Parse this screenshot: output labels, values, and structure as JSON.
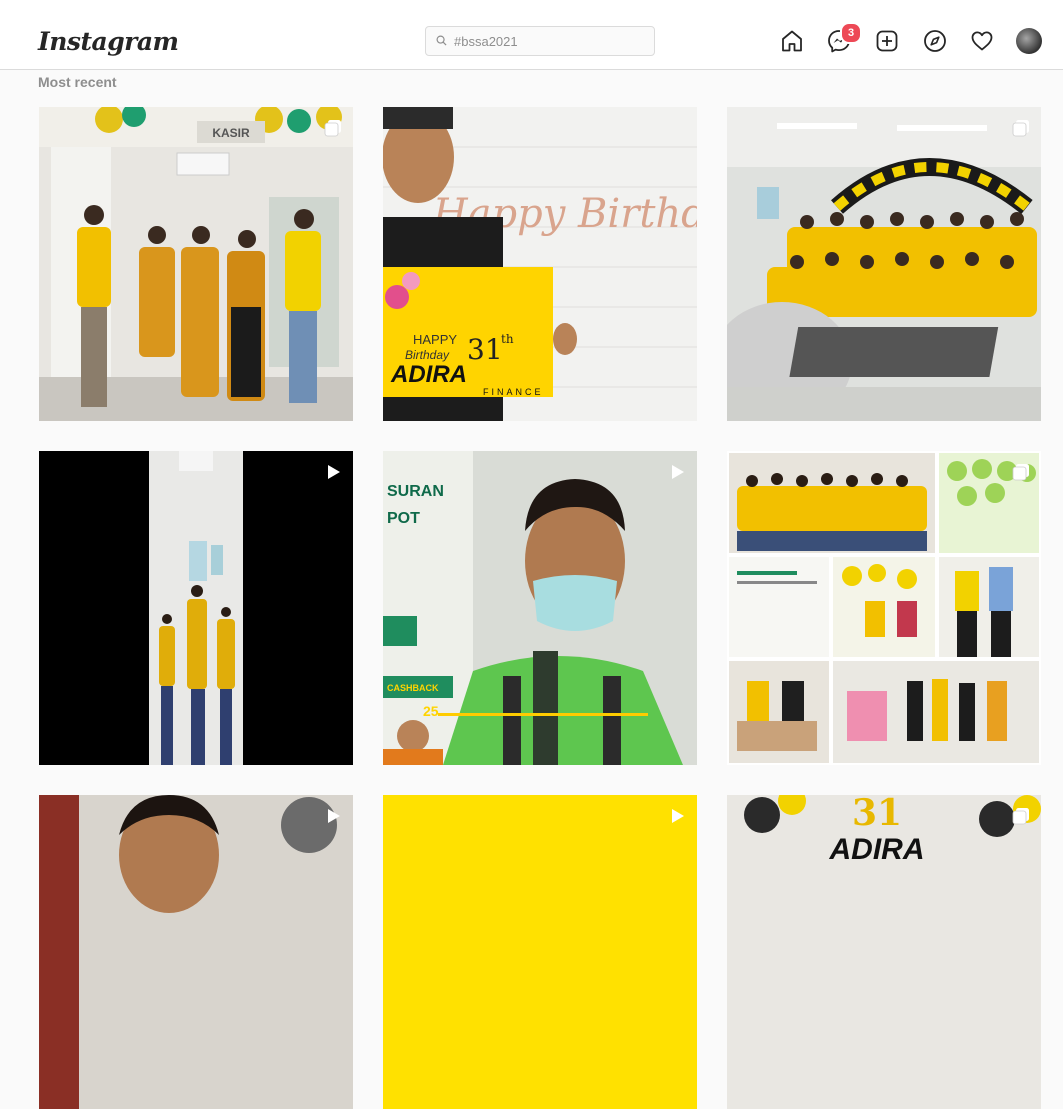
{
  "header": {
    "logo": "Instagram",
    "search_value": "#bssa2021",
    "messages_badge": "3"
  },
  "section": {
    "title": "Most recent"
  },
  "posts": [
    {
      "type": "album",
      "sign": "KASIR"
    },
    {
      "type": "photo",
      "script_text": "Happy Birthday",
      "card_happy": "HAPPY",
      "card_birthday": "Birthday",
      "card_number": "31",
      "card_suffix": "th",
      "brand": "ADIRA",
      "brand_sub": "FINANCE"
    },
    {
      "type": "album"
    },
    {
      "type": "video"
    },
    {
      "type": "video",
      "poster_line1": "SURAN",
      "poster_line2": "POT",
      "poster_cashback": "CASHBACK",
      "poster_amount": "25"
    },
    {
      "type": "album"
    },
    {
      "type": "video"
    },
    {
      "type": "video"
    },
    {
      "type": "album",
      "number": "31",
      "brand": "ADIRA"
    }
  ],
  "colors": {
    "brand_yellow": "#ffd400",
    "badge_red": "#ed4956"
  }
}
